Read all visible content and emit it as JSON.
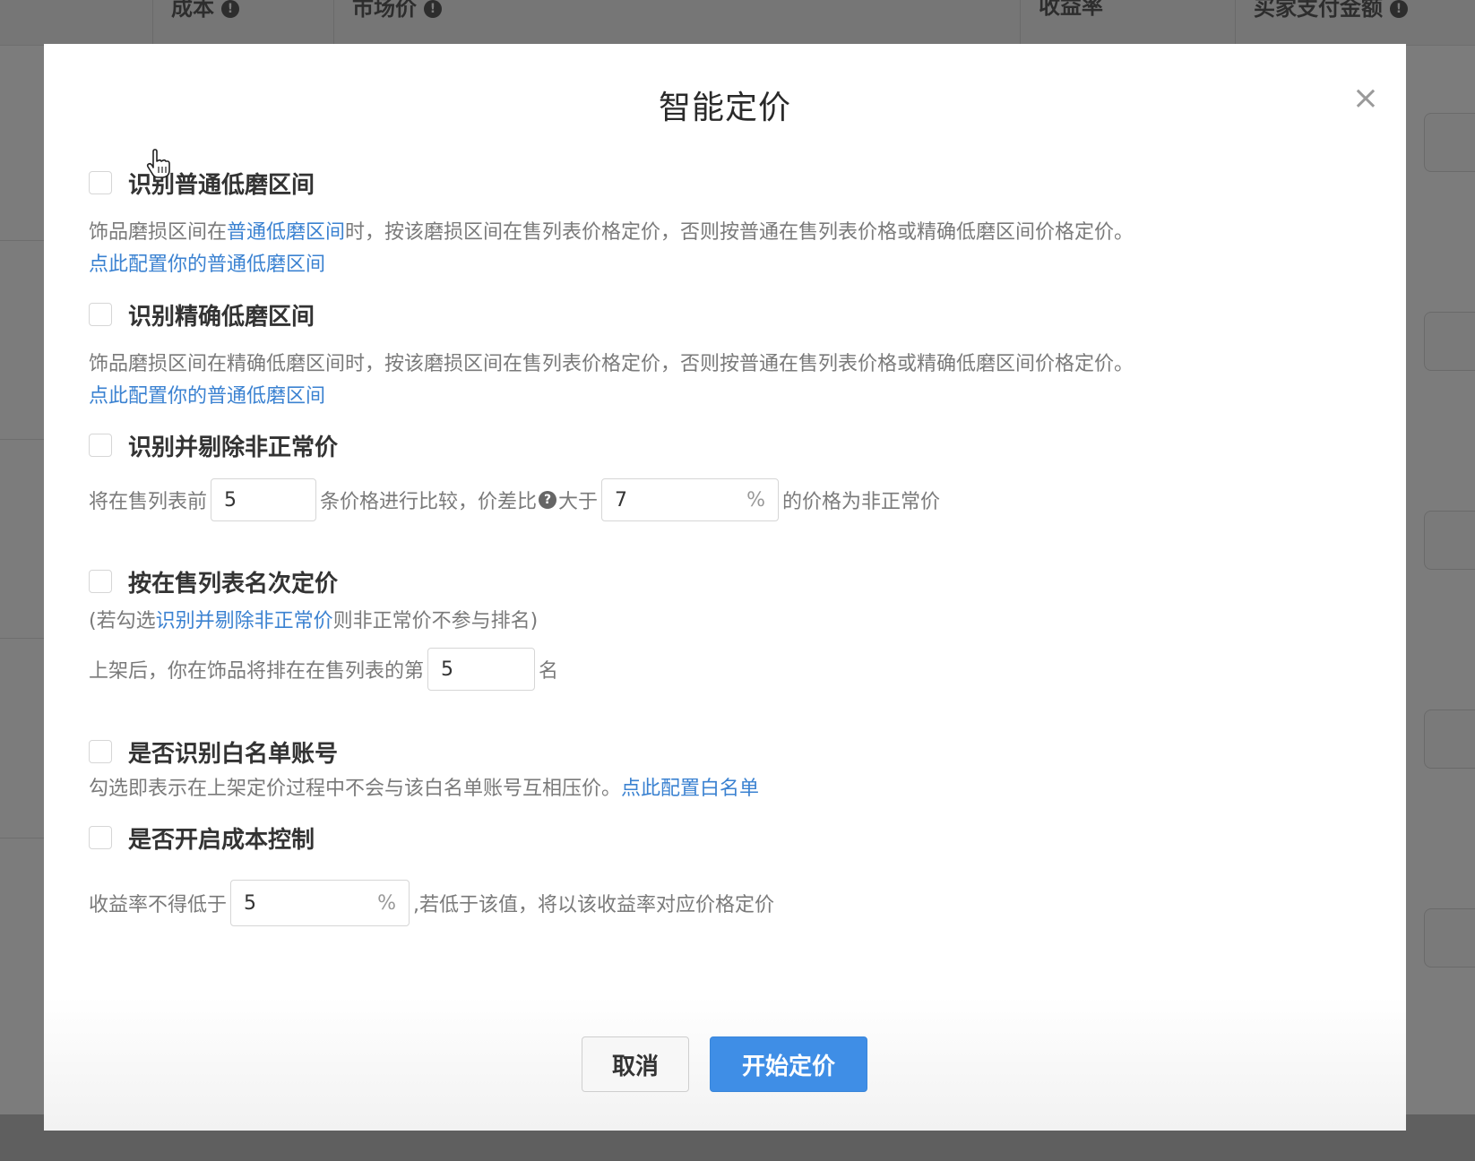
{
  "background": {
    "columns": [
      {
        "label": "成本"
      },
      {
        "label": "市场价"
      },
      {
        "label": "收益率"
      },
      {
        "label": "买家支付金额"
      }
    ]
  },
  "dialog": {
    "title": "智能定价",
    "close_icon": "close-icon",
    "options": {
      "normal_low_wear": {
        "label": "识别普通低磨区间",
        "desc_prefix": "饰品磨损区间在",
        "desc_link": "普通低磨区间",
        "desc_suffix": "时，按该磨损区间在售列表价格定价，否则按普通在售列表价格或精确低磨区间价格定价。",
        "config_link": "点此配置你的普通低磨区间"
      },
      "precise_low_wear": {
        "label": "识别精确低磨区间",
        "desc": "饰品磨损区间在精确低磨区间时，按该磨损区间在售列表价格定价，否则按普通在售列表价格或精确低磨区间价格定价。",
        "config_link": "点此配置你的普通低磨区间"
      },
      "abnormal_price": {
        "label": "识别并剔除非正常价",
        "text_before": "将在售列表前",
        "count_value": "5",
        "text_middle": "条价格进行比较，价差比",
        "text_after_icon": "大于",
        "percent_value": "7",
        "percent_suffix": "%",
        "text_end": "的价格为非正常价"
      },
      "rank_pricing": {
        "label": "按在售列表名次定价",
        "note_prefix": "(若勾选",
        "note_link": "识别并剔除非正常价",
        "note_suffix": "则非正常价不参与排名)",
        "text_before": "上架后，你在饰品将排在在售列表的第",
        "rank_value": "5",
        "text_after": "名"
      },
      "whitelist": {
        "label": "是否识别白名单账号",
        "desc": "勾选即表示在上架定价过程中不会与该白名单账号互相压价。",
        "config_link": "点此配置白名单"
      },
      "cost_control": {
        "label": "是否开启成本控制",
        "text_before": "收益率不得低于",
        "rate_value": "5",
        "rate_suffix": "%",
        "text_after": ",若低于该值，将以该收益率对应价格定价"
      }
    },
    "buttons": {
      "cancel": "取消",
      "start": "开始定价"
    }
  },
  "colors": {
    "primary": "#3f8ee6",
    "link": "#3b82d1",
    "overlay": "#7c7c7c"
  }
}
